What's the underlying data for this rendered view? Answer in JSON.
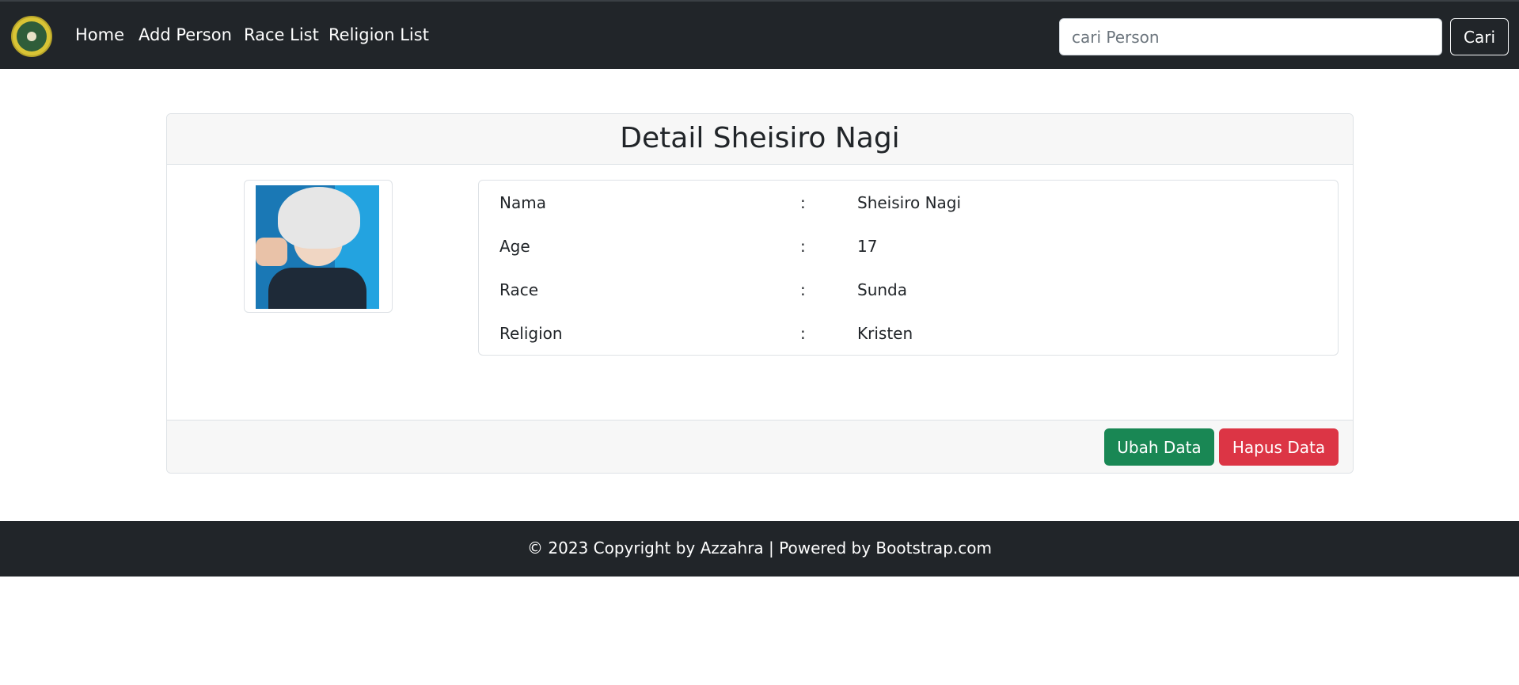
{
  "navbar": {
    "logo_icon": "university-seal-logo",
    "links": [
      {
        "label": "Home"
      },
      {
        "label": "Add Person"
      },
      {
        "label": "Race List"
      },
      {
        "label": "Religion List"
      }
    ],
    "search": {
      "placeholder": "cari Person",
      "value": "",
      "button_label": "Cari"
    }
  },
  "detail": {
    "title": "Detail Sheisiro Nagi",
    "photo_icon": "anime-portrait-image",
    "fields": [
      {
        "label": "Nama",
        "separator": ":",
        "value": "Sheisiro Nagi"
      },
      {
        "label": "Age",
        "separator": ":",
        "value": "17"
      },
      {
        "label": "Race",
        "separator": ":",
        "value": "Sunda"
      },
      {
        "label": "Religion",
        "separator": ":",
        "value": "Kristen"
      }
    ],
    "actions": {
      "edit_label": "Ubah Data",
      "delete_label": "Hapus Data"
    }
  },
  "footer": {
    "text": "© 2023 Copyright by Azzahra  |  Powered by Bootstrap.com"
  },
  "colors": {
    "navbar_bg": "#212529",
    "success": "#198754",
    "danger": "#dc3545"
  }
}
